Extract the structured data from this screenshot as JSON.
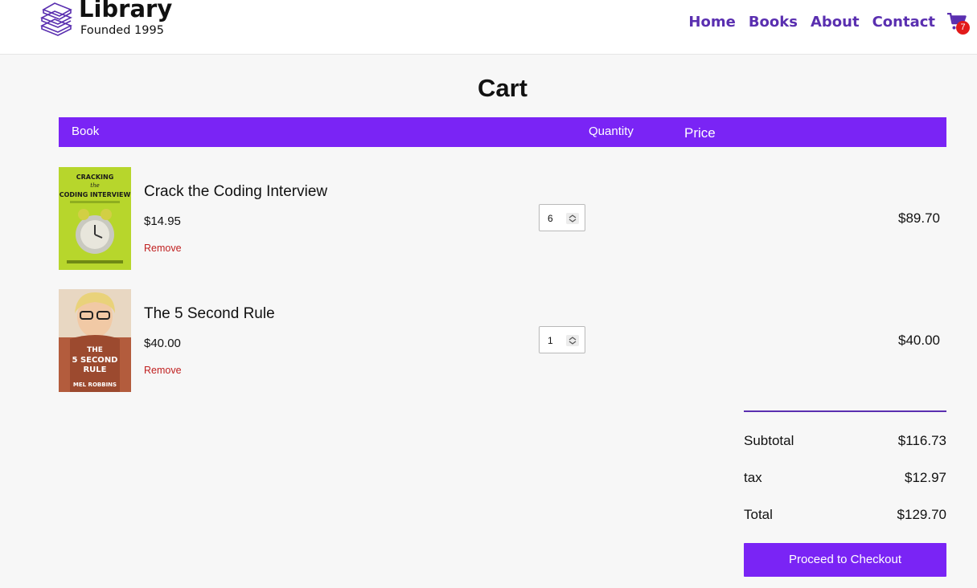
{
  "header": {
    "logo_title": "Library",
    "logo_subtitle": "Founded 1995",
    "nav": [
      "Home",
      "Books",
      "About",
      "Contact"
    ],
    "cart_count": "7",
    "icons": {
      "logo": "books-stack-icon",
      "cart": "cart-icon"
    }
  },
  "page": {
    "title": "Cart"
  },
  "table": {
    "headers": {
      "book": "Book",
      "quantity": "Quantity",
      "price": "Price"
    }
  },
  "items": [
    {
      "title": "Crack the Coding Interview",
      "unit_price": "$14.95",
      "quantity": "6",
      "line_total": "$89.70",
      "remove_label": "Remove",
      "cover_text": [
        "CRACKING",
        "the",
        "CODING INTERVIEW"
      ]
    },
    {
      "title": "The 5 Second Rule",
      "unit_price": "$40.00",
      "quantity": "1",
      "line_total": "$40.00",
      "remove_label": "Remove",
      "cover_text": [
        "THE",
        "5 SECOND",
        "RULE",
        "MEL ROBBINS"
      ]
    }
  ],
  "summary": {
    "subtotal_label": "Subtotal",
    "subtotal": "$116.73",
    "tax_label": "tax",
    "tax": "$12.97",
    "total_label": "Total",
    "total": "$129.70",
    "checkout_label": "Proceed to Checkout"
  },
  "colors": {
    "accent": "#7a24f5",
    "nav": "#5a2fb0",
    "remove": "#c02020",
    "badge": "#e21b1b"
  }
}
